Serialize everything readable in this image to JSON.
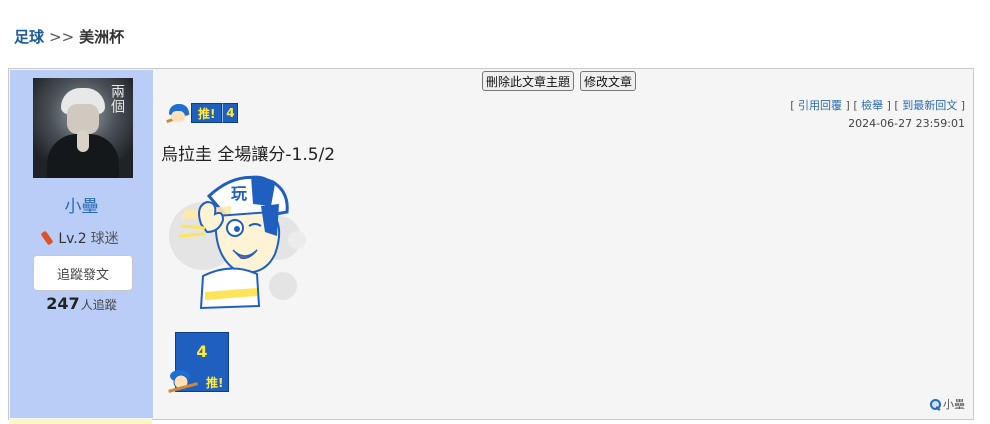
{
  "breadcrumb": {
    "section": "足球",
    "separator": ">>",
    "current": "美洲杯"
  },
  "post": {
    "buttons": {
      "delete_topic": "刪除此文章主題",
      "edit_post": "修改文章"
    },
    "push": {
      "label": "推!",
      "count": "4"
    },
    "links": {
      "quote": "引用回覆",
      "report": "檢舉",
      "latest": "到最新回文"
    },
    "timestamp": "2024-06-27 23:59:01",
    "title": "烏拉圭 全場讓分-1.5/2",
    "mascot_text": "玩",
    "push_big": {
      "count": "4",
      "label": "推!"
    },
    "author_link": "小壘"
  },
  "author": {
    "name": "小壘",
    "level": "Lv.2",
    "rank": "球迷",
    "follow_button": "追蹤發文",
    "followers_count": "247",
    "followers_label": "人追蹤",
    "avatar_text": "兩個"
  },
  "colors": {
    "sidebar": "#b9cdf6",
    "link": "#2a6bb5",
    "badge": "#1f5fbf",
    "badge_text": "#ffea3a"
  }
}
